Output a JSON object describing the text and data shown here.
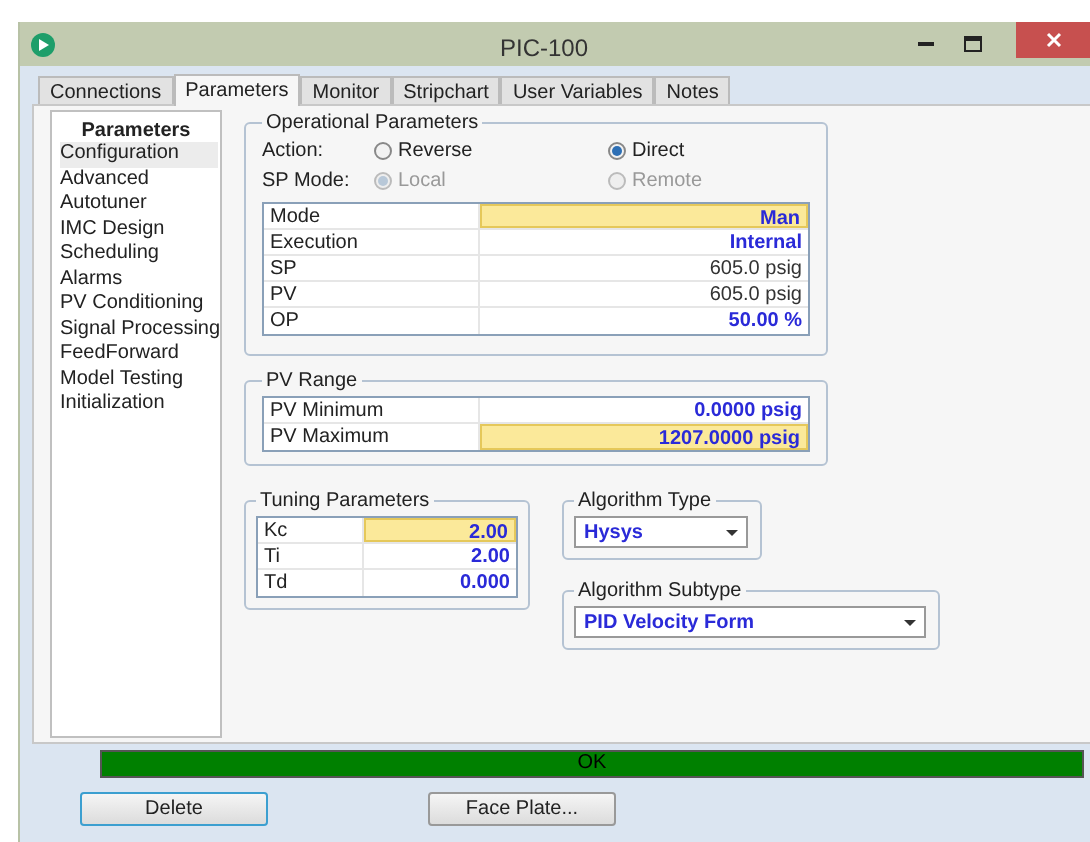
{
  "window": {
    "title": "PIC-100"
  },
  "tabs": [
    {
      "label": "Connections",
      "selected": false
    },
    {
      "label": "Parameters",
      "selected": true
    },
    {
      "label": "Monitor",
      "selected": false
    },
    {
      "label": "Stripchart",
      "selected": false
    },
    {
      "label": "User Variables",
      "selected": false
    },
    {
      "label": "Notes",
      "selected": false
    }
  ],
  "sidebar": {
    "title": "Parameters",
    "items": [
      {
        "label": "Configuration",
        "selected": true
      },
      {
        "label": "Advanced",
        "selected": false
      },
      {
        "label": "Autotuner",
        "selected": false
      },
      {
        "label": "IMC Design",
        "selected": false
      },
      {
        "label": "Scheduling",
        "selected": false
      },
      {
        "label": "Alarms",
        "selected": false
      },
      {
        "label": "PV Conditioning",
        "selected": false
      },
      {
        "label": "Signal Processing",
        "selected": false
      },
      {
        "label": "FeedForward",
        "selected": false
      },
      {
        "label": "Model Testing",
        "selected": false
      },
      {
        "label": "Initialization",
        "selected": false
      }
    ]
  },
  "operational_parameters": {
    "title": "Operational Parameters",
    "radio_groups": [
      {
        "label": "Action:",
        "options": [
          {
            "label": "Reverse",
            "selected": false,
            "disabled": false
          },
          {
            "label": "Direct",
            "selected": true,
            "disabled": false
          }
        ]
      },
      {
        "label": "SP Mode:",
        "options": [
          {
            "label": "Local",
            "selected": true,
            "disabled": true
          },
          {
            "label": "Remote",
            "selected": false,
            "disabled": true
          }
        ]
      }
    ],
    "rows": [
      {
        "name": "Mode",
        "value": "Man",
        "highlighted": true,
        "editable": true
      },
      {
        "name": "Execution",
        "value": "Internal",
        "highlighted": false,
        "editable": true
      },
      {
        "name": "SP",
        "value": "605.0 psig",
        "highlighted": false,
        "editable": false
      },
      {
        "name": "PV",
        "value": "605.0 psig",
        "highlighted": false,
        "editable": false
      },
      {
        "name": "OP",
        "value": "50.00 %",
        "highlighted": false,
        "editable": true
      }
    ]
  },
  "pv_range": {
    "title": "PV Range",
    "rows": [
      {
        "name": "PV Minimum",
        "value": "0.0000 psig",
        "highlighted": false,
        "editable": true
      },
      {
        "name": "PV Maximum",
        "value": "1207.0000 psig",
        "highlighted": true,
        "editable": true
      }
    ]
  },
  "tuning_parameters": {
    "title": "Tuning Parameters",
    "rows": [
      {
        "name": "Kc",
        "value": "2.00",
        "highlighted": true,
        "editable": true
      },
      {
        "name": "Ti",
        "value": "2.00",
        "highlighted": false,
        "editable": true
      },
      {
        "name": "Td",
        "value": "0.000",
        "highlighted": false,
        "editable": true
      }
    ]
  },
  "algorithm_type": {
    "title": "Algorithm Type",
    "value": "Hysys"
  },
  "algorithm_subtype": {
    "title": "Algorithm Subtype",
    "value": "PID Velocity Form"
  },
  "status_bar": {
    "text": "OK"
  },
  "buttons": [
    "Delete",
    "Face Plate..."
  ]
}
